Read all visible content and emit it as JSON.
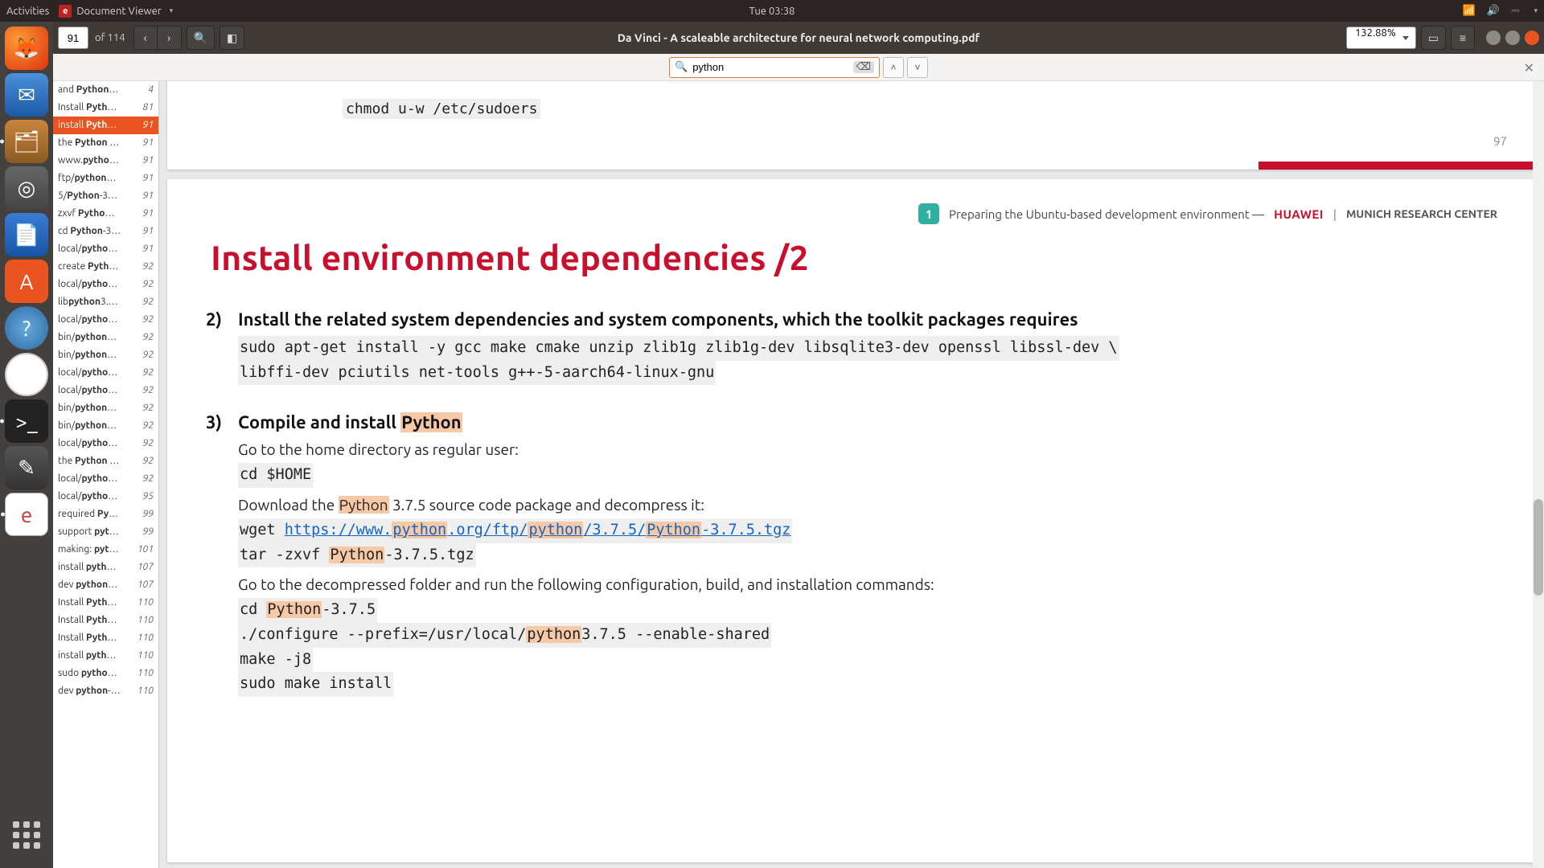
{
  "topbar": {
    "activities": "Activities",
    "app_name": "Document Viewer",
    "clock": "Tue 03:38"
  },
  "toolbar": {
    "page_current": "91",
    "page_total": "of 114",
    "doc_title": "Da Vinci - A scaleable architecture for neural network computing.pdf",
    "zoom": "132.88%"
  },
  "find": {
    "query": "python"
  },
  "sidebar": {
    "items": [
      {
        "pre": "and ",
        "b": "Python",
        "post": "…",
        "pg": "4"
      },
      {
        "pre": "Install ",
        "b": "Pyth",
        "post": "…",
        "pg": "81"
      },
      {
        "pre": "install ",
        "b": "Pyth",
        "post": "…",
        "pg": "91",
        "sel": true
      },
      {
        "pre": "the ",
        "b": "Python",
        "post": " …",
        "pg": "91"
      },
      {
        "pre": "www.",
        "b": "pytho",
        "post": "…",
        "pg": "91"
      },
      {
        "pre": "ftp/",
        "b": "python",
        "post": "…",
        "pg": "91"
      },
      {
        "pre": "5/",
        "b": "Python",
        "post": "-3…",
        "pg": "91"
      },
      {
        "pre": "zxvf ",
        "b": "Pytho",
        "post": "…",
        "pg": "91"
      },
      {
        "pre": "cd ",
        "b": "Python",
        "post": "-3…",
        "pg": "91"
      },
      {
        "pre": "local/",
        "b": "pytho",
        "post": "…",
        "pg": "91"
      },
      {
        "pre": "create ",
        "b": "Pyth",
        "post": "…",
        "pg": "92"
      },
      {
        "pre": "local/",
        "b": "pytho",
        "post": "…",
        "pg": "92"
      },
      {
        "pre": "lib",
        "b": "python",
        "post": "3.…",
        "pg": "92"
      },
      {
        "pre": "local/",
        "b": "pytho",
        "post": "…",
        "pg": "92"
      },
      {
        "pre": "bin/",
        "b": "python",
        "post": "…",
        "pg": "92"
      },
      {
        "pre": "bin/",
        "b": "python",
        "post": "…",
        "pg": "92"
      },
      {
        "pre": "local/",
        "b": "pytho",
        "post": "…",
        "pg": "92"
      },
      {
        "pre": "local/",
        "b": "pytho",
        "post": "…",
        "pg": "92"
      },
      {
        "pre": "bin/",
        "b": "python",
        "post": "…",
        "pg": "92"
      },
      {
        "pre": "bin/",
        "b": "python",
        "post": "…",
        "pg": "92"
      },
      {
        "pre": "local/",
        "b": "pytho",
        "post": "…",
        "pg": "92"
      },
      {
        "pre": "the ",
        "b": "Python",
        "post": " …",
        "pg": "92"
      },
      {
        "pre": "local/",
        "b": "pytho",
        "post": "…",
        "pg": "92"
      },
      {
        "pre": "local/",
        "b": "pytho",
        "post": "…",
        "pg": "95"
      },
      {
        "pre": "required ",
        "b": "Py",
        "post": "…",
        "pg": "99"
      },
      {
        "pre": "support ",
        "b": "pyt",
        "post": "…",
        "pg": "99"
      },
      {
        "pre": "making: ",
        "b": "pyt",
        "post": "…",
        "pg": "101"
      },
      {
        "pre": "install ",
        "b": "pyth",
        "post": "…",
        "pg": "107"
      },
      {
        "pre": "dev ",
        "b": "python",
        "post": "…",
        "pg": "107"
      },
      {
        "pre": "Install ",
        "b": "Pyth",
        "post": "…",
        "pg": "110"
      },
      {
        "pre": "Install ",
        "b": "Pyth",
        "post": "…",
        "pg": "110"
      },
      {
        "pre": "Install ",
        "b": "Pyth",
        "post": "…",
        "pg": "110"
      },
      {
        "pre": "install ",
        "b": "pyth",
        "post": "…",
        "pg": "110"
      },
      {
        "pre": "sudo ",
        "b": "pytho",
        "post": "…",
        "pg": "110"
      },
      {
        "pre": "dev ",
        "b": "python",
        "post": "-…",
        "pg": "110"
      }
    ]
  },
  "prev_page": {
    "code": "chmod u-w /etc/sudoers",
    "page_number": "97"
  },
  "slide": {
    "step_num": "1",
    "header_text": "Preparing the Ubuntu-based development environment —",
    "brand": "HUAWEI",
    "divider": "|",
    "center": "MUNICH RESEARCH CENTER",
    "title": "Install environment dependencies /2",
    "item2": {
      "num": "2)",
      "lead": "Install the related system dependencies and system components, which the toolkit packages requires",
      "code1": "sudo apt-get install -y gcc make cmake unzip zlib1g zlib1g-dev libsqlite3-dev openssl libssl-dev \\",
      "code2": "libffi-dev pciutils net-tools g++-5-aarch64-linux-gnu"
    },
    "item3": {
      "num": "3)",
      "lead_pre": "Compile and install ",
      "lead_hl": "Python",
      "sub1": "Go to the home directory as regular user:",
      "code_cd_home": "cd $HOME",
      "sub2_pre": "Download the ",
      "sub2_hl": "Python",
      "sub2_post": " 3.7.5 source code package and decompress it:",
      "wget_pre": "wget  ",
      "url_p1": "https://www.",
      "url_hl1": "python",
      "url_p2": ".org/ftp/",
      "url_hl2": "python",
      "url_p3": "/3.7.5/",
      "url_hl3": "Python",
      "url_p4": "-3.7.5.tgz",
      "tar_pre": "tar -zxvf ",
      "tar_hl": "Python",
      "tar_post": "-3.7.5.tgz",
      "sub3": "Go to the decompressed folder and run the following configuration, build, and installation commands:",
      "cd_pre": "cd ",
      "cd_hl": "Python",
      "cd_post": "-3.7.5",
      "conf_pre": "./configure --prefix=/usr/local/",
      "conf_hl": "python",
      "conf_post": "3.7.5 --enable-shared",
      "make": "make -j8",
      "install": "sudo make install"
    }
  }
}
